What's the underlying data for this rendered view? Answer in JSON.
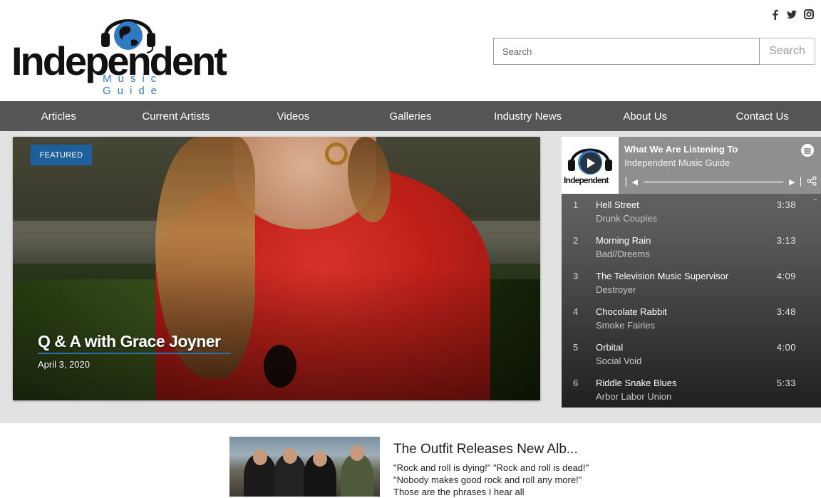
{
  "logo": {
    "word": "Independent",
    "sub": "Music Guide"
  },
  "social": [
    {
      "icon": "facebook-icon",
      "glyph": "f"
    },
    {
      "icon": "twitter-icon",
      "glyph": "t"
    },
    {
      "icon": "instagram-icon",
      "glyph": "◘"
    }
  ],
  "search": {
    "placeholder": "Search",
    "button": "Search"
  },
  "nav": [
    "Articles",
    "Current Artists",
    "Videos",
    "Galleries",
    "Industry News",
    "About Us",
    "Contact Us"
  ],
  "featured": {
    "badge": "FEATURED",
    "title": "Q & A with Grace Joyner",
    "date": "April 3, 2020"
  },
  "player": {
    "title": "What We Are Listening To",
    "subtitle": "Independent Music Guide",
    "art_word": "Independent",
    "tracks": [
      {
        "num": "1",
        "name": "Hell Street",
        "artist": "Drunk Couples",
        "duration": "3:38"
      },
      {
        "num": "2",
        "name": "Morning Rain",
        "artist": "Bad//Dreems",
        "duration": "3:13"
      },
      {
        "num": "3",
        "name": "The Television Music Supervisor",
        "artist": "Destroyer",
        "duration": "4:09"
      },
      {
        "num": "4",
        "name": "Chocolate Rabbit",
        "artist": "Smoke Fairies",
        "duration": "3:48"
      },
      {
        "num": "5",
        "name": "Orbital",
        "artist": "Social Void",
        "duration": "4:00"
      },
      {
        "num": "6",
        "name": "Riddle Snake Blues",
        "artist": "Arbor Labor Union",
        "duration": "5:33"
      }
    ]
  },
  "article": {
    "title": "The Outfit Releases New Alb...",
    "excerpt": "\"Rock and roll is dying!\" \"Rock and roll is dead!\" \"Nobody makes good rock and roll any more!\" Those are the phrases I hear all"
  },
  "colors": {
    "nav_bg": "#555555",
    "accent": "#1e5f9e",
    "logo_blue": "#2f7bc1"
  }
}
